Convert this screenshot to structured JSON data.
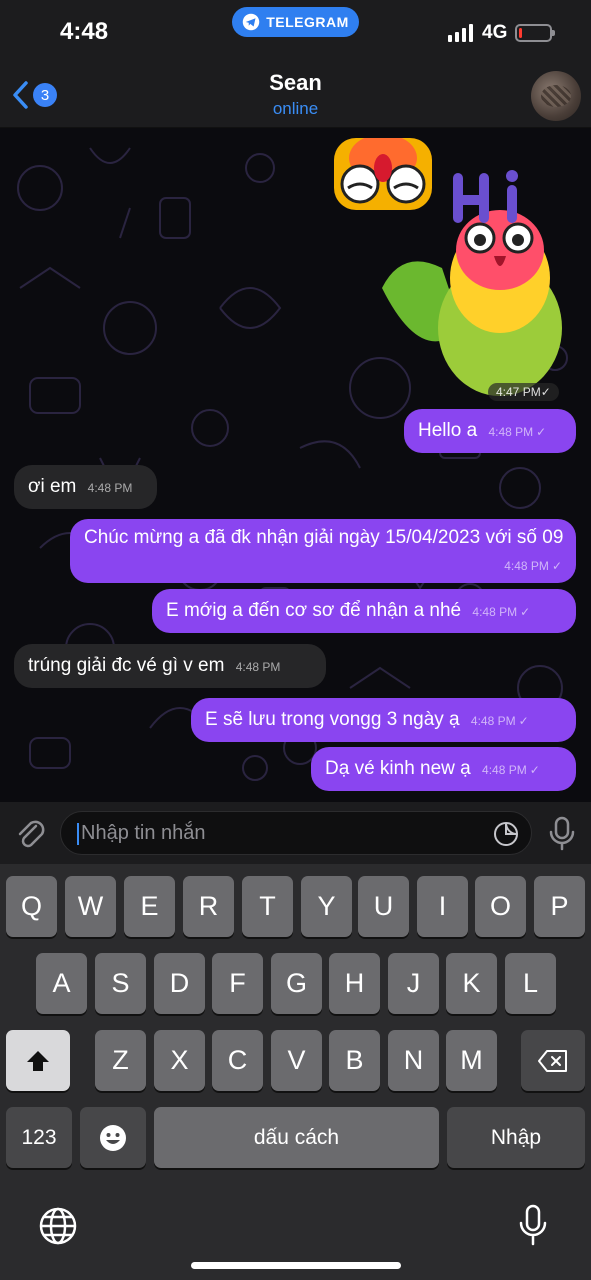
{
  "status_bar": {
    "time": "4:48",
    "app_pill": "TELEGRAM",
    "network": "4G",
    "battery_level": 0.12
  },
  "header": {
    "unread_count": "3",
    "contact_name": "Sean",
    "contact_status": "online"
  },
  "chat": {
    "sticker_time": "4:47 PM",
    "messages": [
      {
        "dir": "out",
        "text": "Hello a",
        "time": "4:48 PM"
      },
      {
        "dir": "in",
        "text": "ơi em",
        "time": "4:48 PM"
      },
      {
        "dir": "out",
        "text": "Chúc mừng a đã đk nhận giải ngày 15/04/2023 với số 09",
        "time": "4:48 PM"
      },
      {
        "dir": "out",
        "text": "E mớig a đến cơ sơ để nhận a nhé",
        "time": "4:48 PM"
      },
      {
        "dir": "in",
        "text": "trúng giải đc vé gì v em",
        "time": "4:48 PM"
      },
      {
        "dir": "out",
        "text": "E sẽ lưu trong vongg 3 ngày ạ",
        "time": "4:48 PM"
      },
      {
        "dir": "out",
        "text": "Dạ vé kinh new ạ",
        "time": "4:48 PM"
      }
    ]
  },
  "input": {
    "placeholder": "Nhập tin nhắn"
  },
  "keyboard": {
    "row1": [
      "Q",
      "W",
      "E",
      "R",
      "T",
      "Y",
      "U",
      "I",
      "O",
      "P"
    ],
    "row2": [
      "A",
      "S",
      "D",
      "F",
      "G",
      "H",
      "J",
      "K",
      "L"
    ],
    "row3": [
      "Z",
      "X",
      "C",
      "V",
      "B",
      "N",
      "M"
    ],
    "numbers_key": "123",
    "space_key": "dấu cách",
    "return_key": "Nhập"
  },
  "icons": {
    "back": "chevron-left-icon",
    "attach": "paperclip-icon",
    "sticker": "sticker-icon",
    "mic": "microphone-icon",
    "globe": "globe-icon",
    "backspace": "backspace-icon",
    "shift": "shift-icon"
  },
  "colors": {
    "outgoing_bubble": "#8a45f0",
    "incoming_bubble": "#262628",
    "accent": "#3a8df5"
  }
}
